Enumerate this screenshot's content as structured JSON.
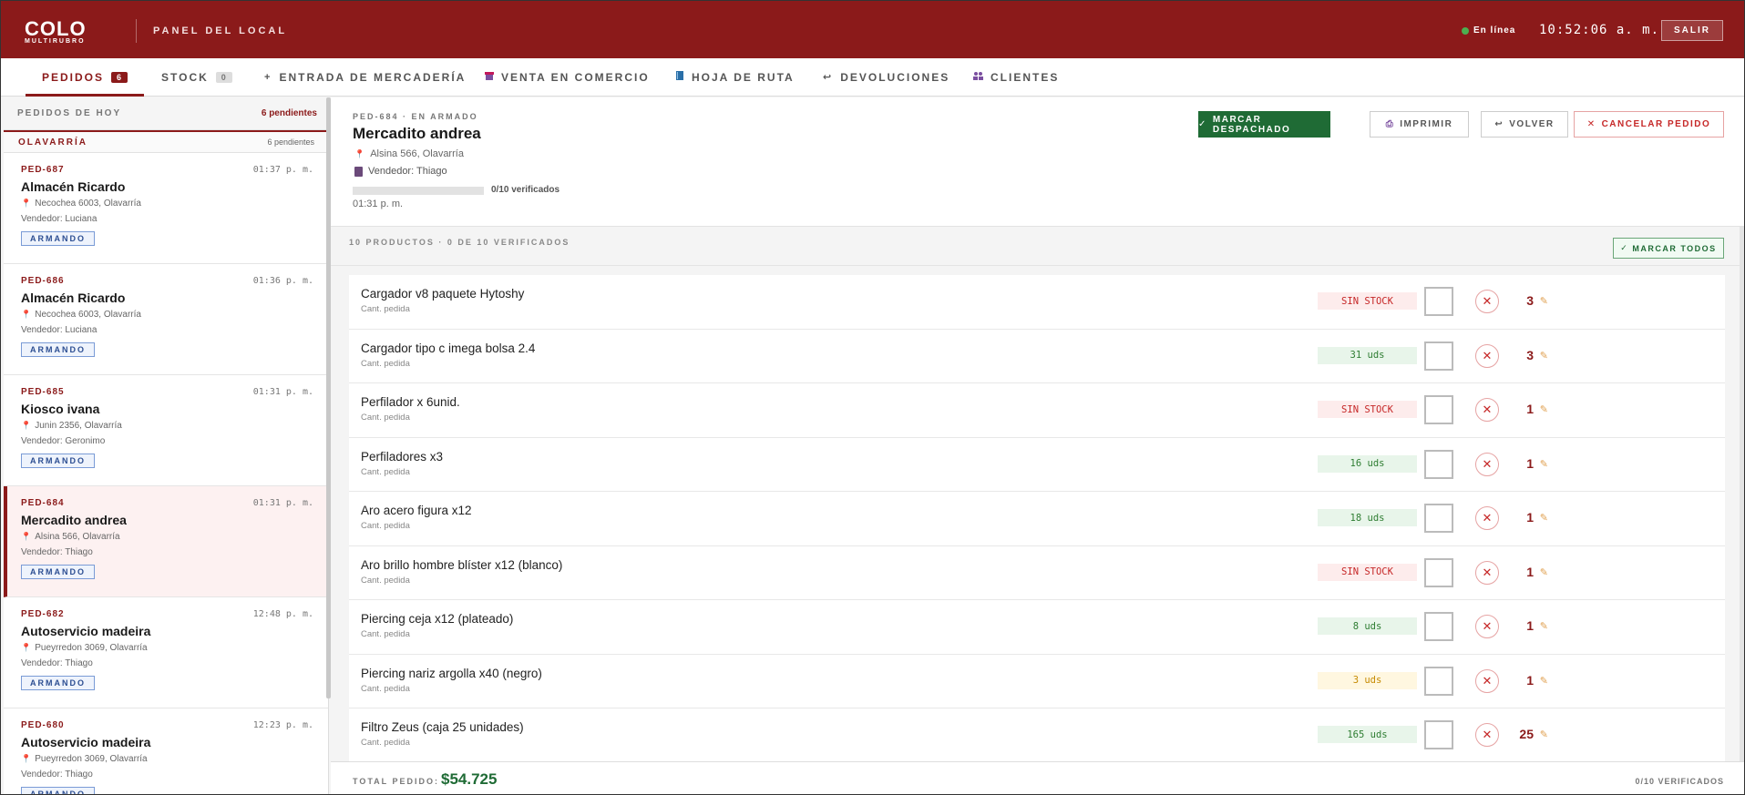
{
  "header": {
    "logo_main": "COLO",
    "logo_sub": "MULTIRUBRO",
    "panel_title": "PANEL DEL LOCAL",
    "status": "En línea",
    "clock": "10:52:06 a. m.",
    "logout_label": "SALIR"
  },
  "tabs": [
    {
      "label": "PEDIDOS",
      "badge": "6",
      "icon": ""
    },
    {
      "label": "STOCK",
      "badge": "0",
      "icon": ""
    },
    {
      "label": "ENTRADA DE MERCADERÍA",
      "icon": "+"
    },
    {
      "label": "VENTA EN COMERCIO",
      "icon": "store-icon"
    },
    {
      "label": "HOJA DE RUTA",
      "icon": "book-icon"
    },
    {
      "label": "DEVOLUCIONES",
      "icon": "return-icon"
    },
    {
      "label": "CLIENTES",
      "icon": "people-icon"
    }
  ],
  "sidebar": {
    "title": "PEDIDOS DE HOY",
    "pending": "6 pendientes",
    "zone": "OLAVARRÍA",
    "zone_pending": "6 pendientes",
    "orders": [
      {
        "code": "PED-687",
        "time": "01:37 p. m.",
        "name": "Almacén Ricardo",
        "address": "Necochea 6003, Olavarría",
        "seller": "Vendedor: Luciana",
        "status": "ARMANDO"
      },
      {
        "code": "PED-686",
        "time": "01:36 p. m.",
        "name": "Almacén Ricardo",
        "address": "Necochea 6003, Olavarría",
        "seller": "Vendedor: Luciana",
        "status": "ARMANDO"
      },
      {
        "code": "PED-685",
        "time": "01:31 p. m.",
        "name": "Kiosco ivana",
        "address": "Junin 2356, Olavarría",
        "seller": "Vendedor: Geronimo",
        "status": "ARMANDO"
      },
      {
        "code": "PED-684",
        "time": "01:31 p. m.",
        "name": "Mercadito andrea",
        "address": "Alsina 566, Olavarría",
        "seller": "Vendedor: Thiago",
        "status": "ARMANDO"
      },
      {
        "code": "PED-682",
        "time": "12:48 p. m.",
        "name": "Autoservicio madeira",
        "address": "Pueyrredon 3069, Olavarría",
        "seller": "Vendedor: Thiago",
        "status": "ARMANDO"
      },
      {
        "code": "PED-680",
        "time": "12:23 p. m.",
        "name": "Autoservicio madeira",
        "address": "Pueyrredon 3069, Olavarría",
        "seller": "Vendedor: Thiago",
        "status": "ARMANDO"
      }
    ]
  },
  "detail": {
    "code": "PED-684 · EN ARMADO",
    "name": "Mercadito andrea",
    "address": "Alsina 566, Olavarría",
    "seller": "Vendedor: Thiago",
    "verified": "0/10 verificados",
    "progress_fraction": 0,
    "time": "01:31 p. m.",
    "buttons": {
      "dispatch": "MARCAR DESPACHADO",
      "print": "IMPRIMIR",
      "back": "VOLVER",
      "cancel": "CANCELAR PEDIDO"
    }
  },
  "products": {
    "summary": "10 PRODUCTOS · 0 DE 10 VERIFICADOS",
    "mark_all": "MARCAR TODOS",
    "qty_caption": "Cant. pedida",
    "items": [
      {
        "name": "Cargador v8 paquete Hytoshy",
        "qty": "3",
        "stock": "SIN STOCK",
        "stock_status": "out"
      },
      {
        "name": "Cargador tipo c imega bolsa 2.4",
        "qty": "3",
        "stock": "31 uds",
        "stock_status": "ok"
      },
      {
        "name": "Perfilador x 6unid.",
        "qty": "1",
        "stock": "SIN STOCK",
        "stock_status": "out"
      },
      {
        "name": "Perfiladores x3",
        "qty": "1",
        "stock": "16 uds",
        "stock_status": "ok"
      },
      {
        "name": "Aro acero figura x12",
        "qty": "1",
        "stock": "18 uds",
        "stock_status": "ok"
      },
      {
        "name": "Aro brillo hombre blíster x12 (blanco)",
        "qty": "1",
        "stock": "SIN STOCK",
        "stock_status": "out"
      },
      {
        "name": "Piercing ceja x12 (plateado)",
        "qty": "1",
        "stock": "8 uds",
        "stock_status": "ok"
      },
      {
        "name": "Piercing nariz argolla x40 (negro)",
        "qty": "1",
        "stock": "3 uds",
        "stock_status": "low"
      },
      {
        "name": "Filtro Zeus (caja 25 unidades)",
        "qty": "25",
        "stock": "165 uds",
        "stock_status": "ok"
      }
    ]
  },
  "footer": {
    "total_label": "TOTAL PEDIDO:",
    "total": "$54.725",
    "verified": "0/10 VERIFICADOS"
  },
  "colors": {
    "brand": "#8b1a1a",
    "success": "#1f6b35",
    "danger": "#c62828"
  }
}
